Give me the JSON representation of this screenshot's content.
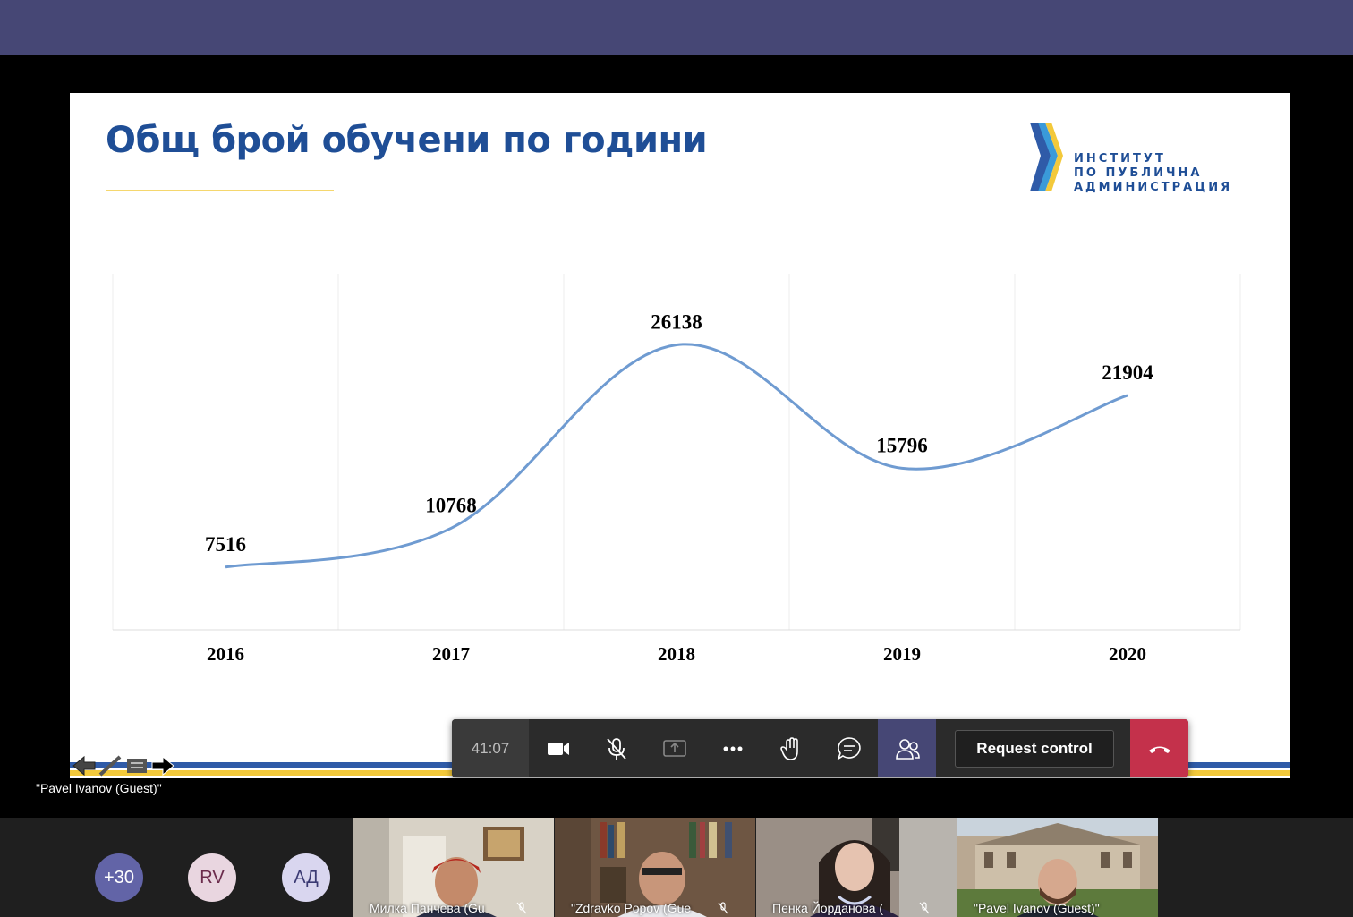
{
  "slide": {
    "title": "Общ брой обучени по години",
    "logo_lines": [
      "ИНСТИТУТ",
      "ПО ПУБЛИЧНА",
      "АДМИНИСТРАЦИЯ"
    ]
  },
  "chart_data": {
    "type": "line",
    "categories": [
      "2016",
      "2017",
      "2018",
      "2019",
      "2020"
    ],
    "values": [
      7516,
      10768,
      26138,
      15796,
      21904
    ],
    "data_labels": [
      "7516",
      "10768",
      "26138",
      "15796",
      "21904"
    ],
    "grid": true,
    "line_color": "#6f9bd1",
    "smooth": true
  },
  "presenter": {
    "label": "\"Pavel Ivanov (Guest)\""
  },
  "meeting_bar": {
    "timer": "41:07",
    "request_control_label": "Request control",
    "active_color": "#464775",
    "hangup_color": "#c4314b"
  },
  "gallery": {
    "avatars": [
      {
        "label": "+30",
        "bg": "#6264a7",
        "fg": "#ffffff"
      },
      {
        "label": "RV",
        "bg": "#e9d6e0",
        "fg": "#6b2c4c"
      },
      {
        "label": "АД",
        "bg": "#d9d6ef",
        "fg": "#3b3a73"
      }
    ],
    "tiles": [
      {
        "name": "Милка Панчева (Gu"
      },
      {
        "name": "\"Zdravko Popov (Gue"
      },
      {
        "name": "Пенка Йорданова ("
      },
      {
        "name": "\"Pavel Ivanov (Guest)\""
      }
    ]
  },
  "icons": {
    "camera": "video-camera-icon",
    "mic": "mic-off-icon",
    "share": "share-screen-icon",
    "more": "more-options-icon",
    "hand": "raise-hand-icon",
    "chat": "chat-icon",
    "people": "participants-icon",
    "hangup": "hang-up-icon"
  }
}
